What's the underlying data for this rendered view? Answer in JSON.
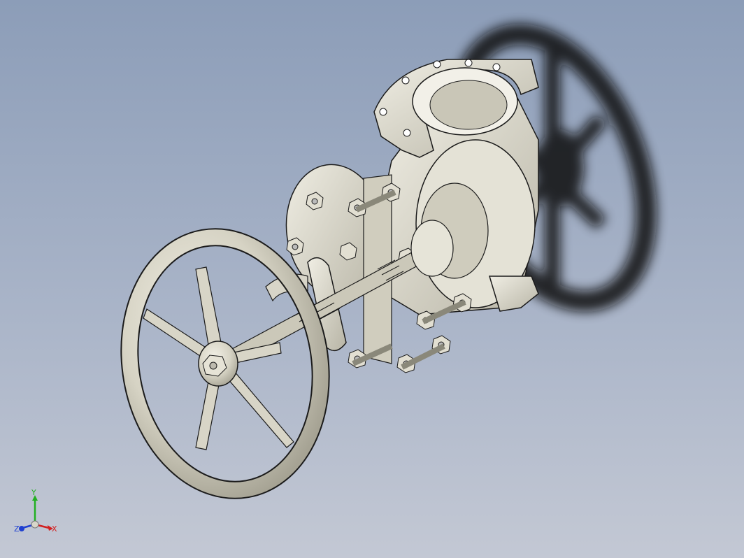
{
  "model": {
    "name": "",
    "colors": {
      "background_top": "#8c9db8",
      "background_bottom": "#c3c8d4",
      "metal": "#d8d6c9",
      "metal_shadow": "#9c9a8c",
      "edge": "#1b1b1b",
      "shadow": "#111111"
    },
    "parts": [
      "handwheel",
      "stem",
      "bonnet",
      "yoke",
      "valve-body",
      "flange",
      "bolts",
      "nuts"
    ]
  },
  "triad": {
    "x_label": "X",
    "y_label": "Y",
    "z_label": "Z",
    "x_color": "#d22020",
    "y_color": "#22b022",
    "z_color": "#2040d0"
  }
}
